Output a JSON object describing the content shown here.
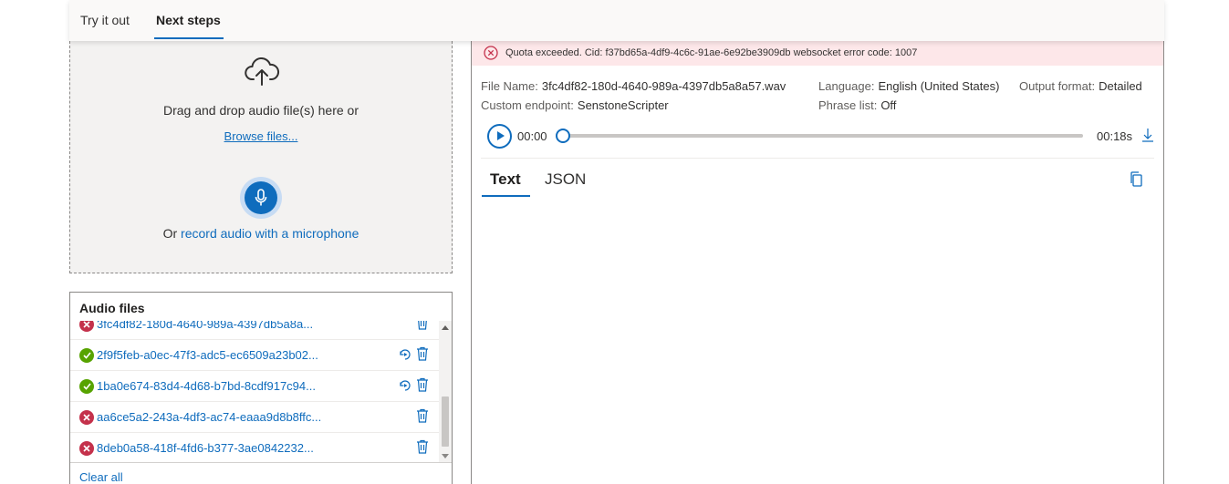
{
  "top_tabs": [
    {
      "label": "Try it out"
    },
    {
      "label": "Next steps"
    }
  ],
  "dropzone": {
    "upload_icon": "cloud-upload-icon",
    "drag_text": "Drag and drop audio file(s) here or",
    "browse_label": "Browse files...",
    "mic_icon": "microphone-icon",
    "record_prefix": "Or",
    "record_link": "record audio with a microphone"
  },
  "audio_files": {
    "title": "Audio files",
    "items": [
      {
        "name": "3fc4df82-180d-4640-989a-4397db5a8a...",
        "status": "error"
      },
      {
        "name": "2f9f5feb-a0ec-47f3-adc5-ec6509a23b02...",
        "status": "success"
      },
      {
        "name": "1ba0e674-83d4-4d68-b7bd-8cdf917c94...",
        "status": "success"
      },
      {
        "name": "aa6ce5a2-243a-4df3-ac74-eaaa9d8b8ffc...",
        "status": "error"
      },
      {
        "name": "8deb0a58-418f-4fd6-b377-3ae0842232...",
        "status": "error"
      }
    ],
    "clear_all": "Clear all"
  },
  "result": {
    "error_message": "Quota exceeded. Cid: f37bd65a-4df9-4c6c-91ae-6e92be3909db websocket error code: 1007",
    "file_name_label": "File Name:",
    "file_name_value": "3fc4df82-180d-4640-989a-4397db5a8a57.wav",
    "language_label": "Language:",
    "language_value": "English (United States)",
    "output_format_label": "Output format:",
    "output_format_value": "Detailed",
    "endpoint_label": "Custom endpoint:",
    "endpoint_value": "SenstoneScripter",
    "phrase_list_label": "Phrase list:",
    "phrase_list_value": "Off",
    "time_start": "00:00",
    "time_end": "00:18s",
    "playback_progress": 0,
    "tabs": [
      {
        "label": "Text"
      },
      {
        "label": "JSON"
      }
    ]
  },
  "colors": {
    "accent": "#0f6cbd",
    "error": "#c4314b",
    "success": "#57a300",
    "error_bg": "#fde7e9"
  }
}
